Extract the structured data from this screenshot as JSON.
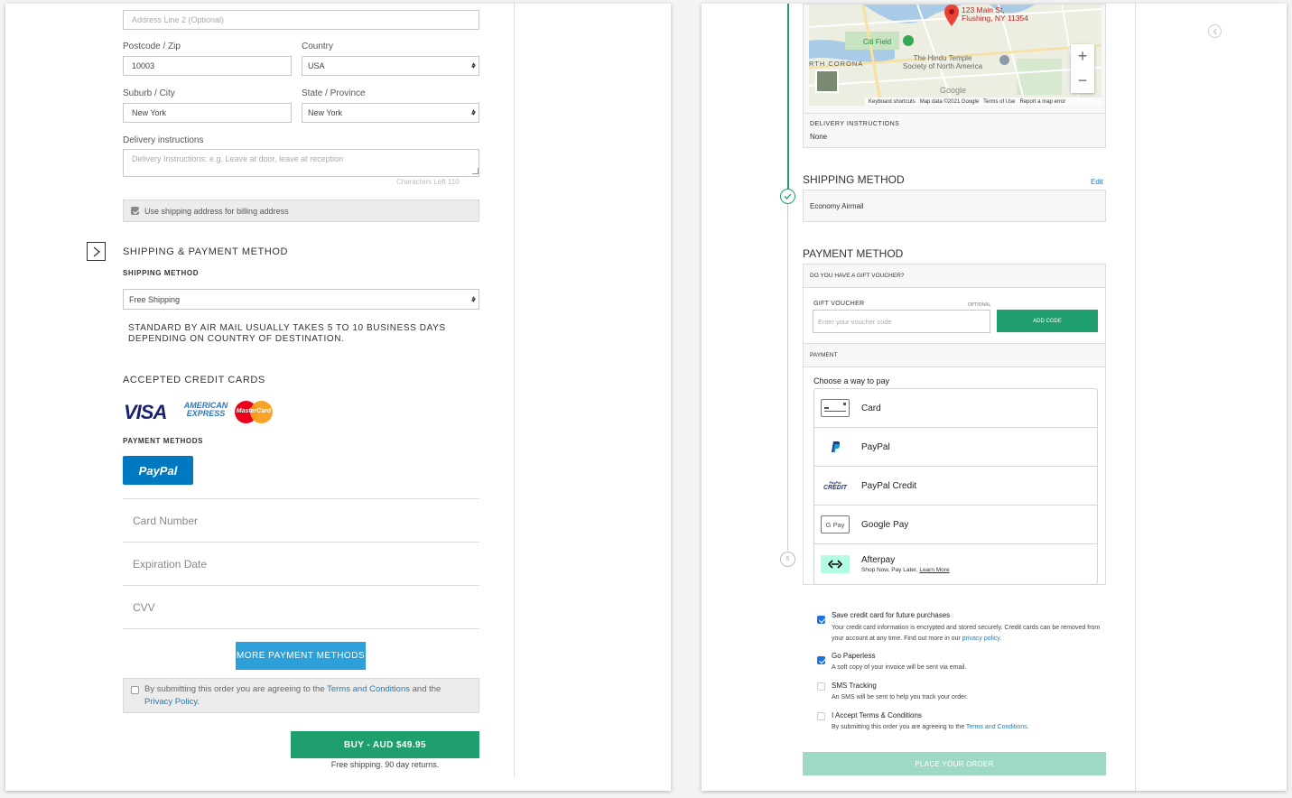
{
  "left": {
    "address2_placeholder": "Address Line 2 (Optional)",
    "postcode_label": "Postcode / Zip",
    "postcode_value": "10003",
    "country_label": "Country",
    "country_value": "USA",
    "city_label": "Suburb / City",
    "city_value": "New York",
    "state_label": "State / Province",
    "state_value": "New York",
    "delivery_label": "Delivery instructions",
    "delivery_placeholder": "Delivery Instructions: e.g. Leave at door, leave at reception",
    "chars_left": "Characters Left 110",
    "billing_checkbox_label": "Use shipping address for billing address",
    "section_title": "SHIPPING & PAYMENT METHOD",
    "shipping_method_title": "SHIPPING METHOD",
    "shipping_select_value": "Free Shipping",
    "shipping_note": "STANDARD BY AIR MAIL USUALLY TAKES 5 TO 10 BUSINESS DAYS DEPENDING ON COUNTRY OF DESTINATION.",
    "accepted_cards_title": "ACCEPTED CREDIT CARDS",
    "visa_text": "VISA",
    "amex_line1": "AMERICAN",
    "amex_line2": "EXPRESS",
    "mastercard_text": "MasterCard",
    "payment_methods_title": "PAYMENT METHODS",
    "paypal_button": "PayPal",
    "card_number_placeholder": "Card Number",
    "expiration_placeholder": "Expiration Date",
    "cvv_placeholder": "CVV",
    "more_methods_button": "MORE PAYMENT METHODS",
    "terms_prefix": "By submitting this order you are agreeing to the ",
    "terms_link": "Terms and Conditions",
    "terms_mid": " and the ",
    "privacy_link": "Privacy Policy",
    "terms_suffix": ".",
    "buy_button": "BUY - AUD $49.95",
    "free_shipping_note": "Free shipping. 90 day returns."
  },
  "right": {
    "map": {
      "address_line1": "123 Main St,",
      "address_line2": "Flushing, NY 11354",
      "citi_field": "Citi Field",
      "corona": "RTH CORONA",
      "temple_line1": "The Hindu Temple",
      "temple_line2": "Society of North America",
      "google": "Google",
      "footer_shortcuts": "Keyboard shortcuts",
      "footer_mapdata": "Map data ©2021 Google",
      "footer_terms": "Terms of Use",
      "footer_report": "Report a map error",
      "zoom_in": "+",
      "zoom_out": "−"
    },
    "delivery_instructions_title": "DELIVERY INSTRUCTIONS",
    "delivery_instructions_value": "None",
    "shipping_method_title": "SHIPPING METHOD",
    "shipping_edit": "Edit",
    "shipping_method_value": "Economy Airmail",
    "payment_method_title": "PAYMENT METHOD",
    "gift_voucher_question": "DO YOU HAVE A GIFT VOUCHER?",
    "gift_voucher_label": "GIFT VOUCHER",
    "gift_voucher_optional": "OPTIONAL",
    "gift_voucher_placeholder": "Enter your voucher code",
    "add_code_button": "ADD CODE",
    "payment_title": "PAYMENT",
    "choose_way": "Choose a way to pay",
    "step_number": "5",
    "pay_options": [
      {
        "label": "Card"
      },
      {
        "label": "PayPal"
      },
      {
        "label": "PayPal Credit"
      },
      {
        "label": "Google Pay"
      },
      {
        "label": "Afterpay",
        "sub": "Shop Now, Pay Later.",
        "link": "Learn More"
      }
    ],
    "paypal_credit_top": "PayPal",
    "paypal_credit_bottom": "CREDIT",
    "gpay_text": "G Pay",
    "save_card_label": "Save credit card for future purchases",
    "save_card_desc": "Your credit card information is encrypted and stored securely. Credit cards can be removed from your account at any time. Find out more in our ",
    "save_card_link": "privacy policy",
    "save_card_end": ".",
    "paperless_label": "Go Paperless",
    "paperless_desc": "A soft copy of your invoice will be sent via email.",
    "sms_label": "SMS Tracking",
    "sms_desc": "An SMS will be sent to help you track your order.",
    "terms_label": "I Accept Terms & Conditions",
    "terms_desc": "By submitting this order you are agreeing to the ",
    "terms_link": "Terms and Conditions",
    "terms_end": ".",
    "place_order_button": "PLACE YOUR ORDER"
  },
  "colors": {
    "green": "#1f9e6e",
    "green_light": "#9ed9c3",
    "blue": "#2d9fd9",
    "paypal_blue": "#0079c1",
    "link": "#2a7ab8"
  }
}
